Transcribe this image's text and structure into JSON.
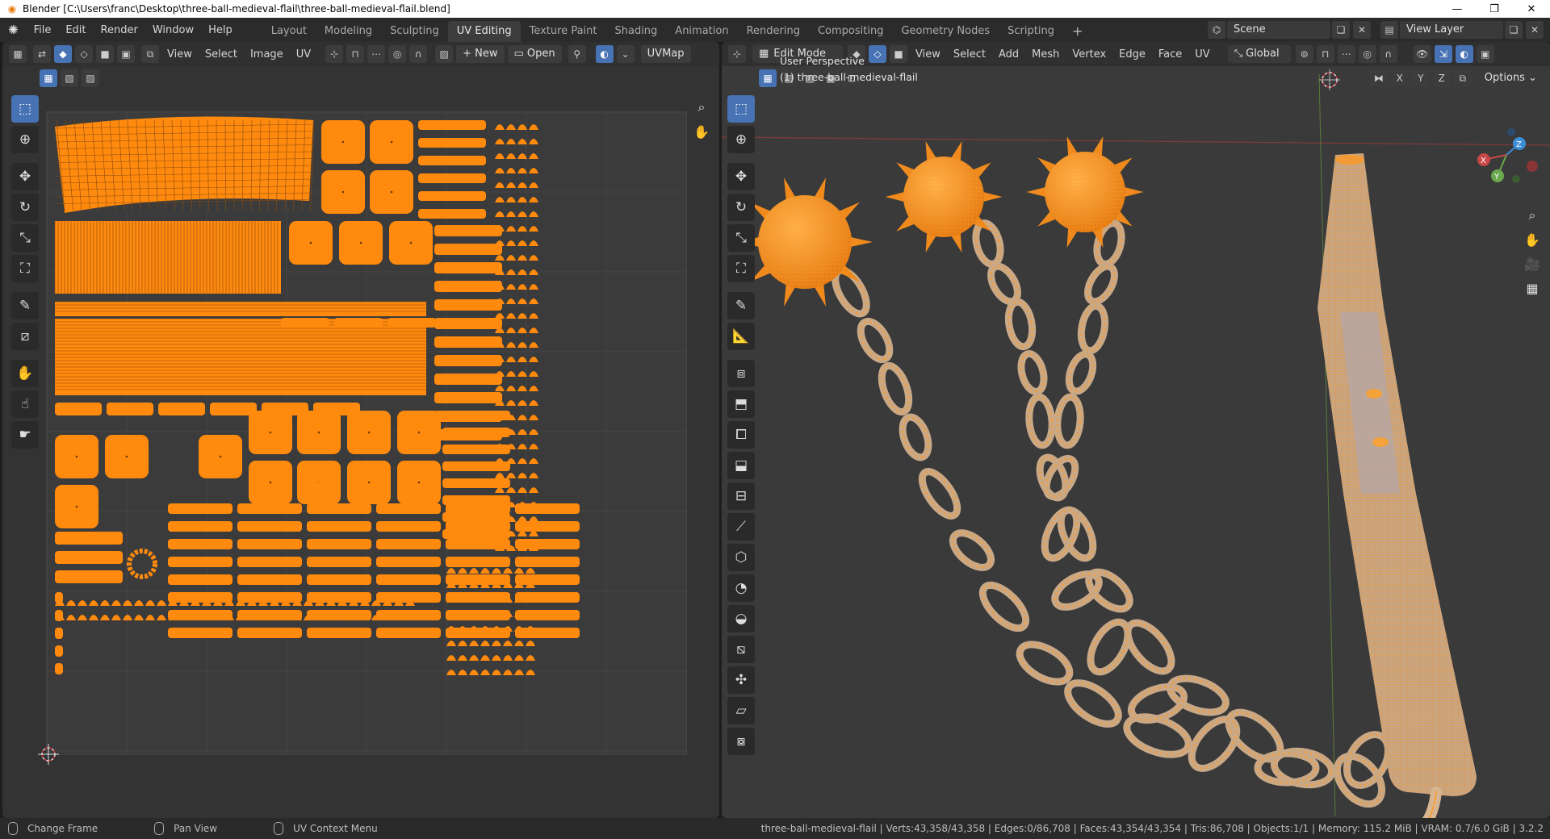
{
  "window": {
    "title": "Blender [C:\\Users\\franc\\Desktop\\three-ball-medieval-flail\\three-ball-medieval-flail.blend]",
    "controls": [
      "—",
      "❐",
      "✕"
    ]
  },
  "menu": [
    "File",
    "Edit",
    "Render",
    "Window",
    "Help"
  ],
  "workspaces": [
    "Layout",
    "Modeling",
    "Sculpting",
    "UV Editing",
    "Texture Paint",
    "Shading",
    "Animation",
    "Rendering",
    "Compositing",
    "Geometry Nodes",
    "Scripting",
    "+"
  ],
  "scene": {
    "name": "Scene",
    "view_layer": "View Layer"
  },
  "uv_editor": {
    "menus": [
      "View",
      "Select",
      "Image",
      "UV"
    ],
    "new_label": "New",
    "open_label": "Open",
    "uvmap_label": "UVMap"
  },
  "viewport": {
    "mode": "Edit Mode",
    "menus": [
      "View",
      "Select",
      "Add",
      "Mesh",
      "Vertex",
      "Edge",
      "Face",
      "UV"
    ],
    "orientation": "Global",
    "options_label": "Options",
    "axes": [
      "X",
      "Y",
      "Z"
    ],
    "info_line1": "User Perspective",
    "info_line2": "(1) three-ball-medieval-flail"
  },
  "statusbar": {
    "hints": [
      "Change Frame",
      "Pan View",
      "UV Context Menu"
    ],
    "stats": "three-ball-medieval-flail | Verts:43,358/43,358 | Edges:0/86,708 | Faces:43,354/43,354 | Tris:86,708 | Objects:1/1 | Memory: 115.2 MiB | VRAM: 0.7/6.0 GiB | 3.2.2"
  },
  "colors": {
    "accent": "#4772b3",
    "uv_island": "#ff8a0d",
    "wire": "#ff8c1a",
    "mesh": "#c7a37f"
  },
  "icons": {
    "uv_tools": [
      "select-box-icon",
      "cursor-icon",
      "move-icon",
      "rotate-icon",
      "scale-icon",
      "transform-icon",
      "annotate-icon",
      "rip-icon",
      "grab-icon",
      "relax-icon",
      "pinch-icon"
    ],
    "view3d_tools": [
      "select-box-icon",
      "cursor-icon",
      "move-icon",
      "rotate-icon",
      "scale-icon",
      "transform-icon",
      "annotate-icon",
      "measure-icon",
      "add-cube-icon",
      "extrude-icon",
      "inset-icon",
      "bevel-icon",
      "loop-cut-icon",
      "knife-icon",
      "poly-build-icon",
      "spin-icon",
      "smooth-icon",
      "edge-slide-icon",
      "shrink-icon",
      "shear-icon",
      "rip-region-icon"
    ]
  }
}
